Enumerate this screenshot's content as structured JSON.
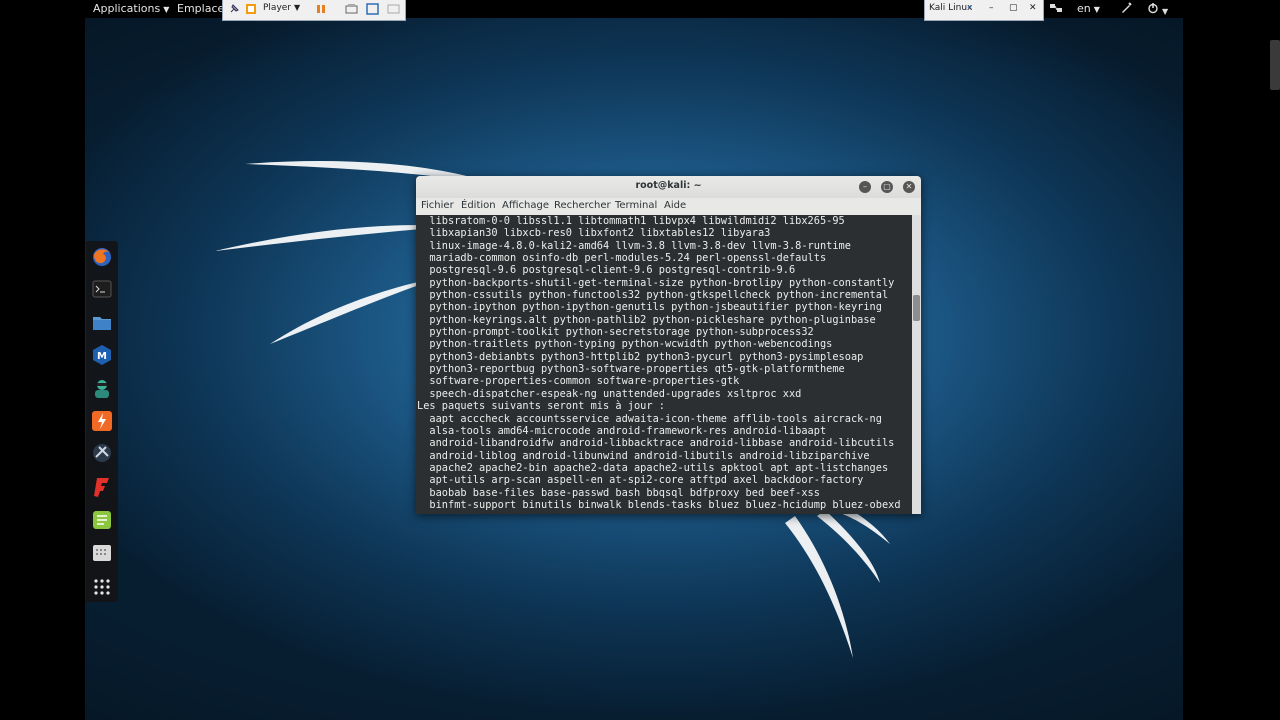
{
  "top_panel": {
    "applications": "Applications",
    "places": "Emplacements",
    "language": "en"
  },
  "vm_toolbar": {
    "player_label": "Player",
    "vm_name": "Kali Linux"
  },
  "dock_items": [
    {
      "name": "firefox-icon"
    },
    {
      "name": "terminal-icon"
    },
    {
      "name": "files-icon"
    },
    {
      "name": "maltego-icon"
    },
    {
      "name": "user-app-icon"
    },
    {
      "name": "burpsuite-icon"
    },
    {
      "name": "tool-icon"
    },
    {
      "name": "faraday-icon"
    },
    {
      "name": "notes-icon"
    },
    {
      "name": "keyboard-icon"
    },
    {
      "name": "show-apps-icon"
    }
  ],
  "terminal": {
    "title": "root@kali: ~",
    "menus": [
      "Fichier",
      "Édition",
      "Affichage",
      "Rechercher",
      "Terminal",
      "Aide"
    ],
    "lines": [
      "  libsratom-0-0 libssl1.1 libtommath1 libvpx4 libwildmidi2 libx265-95",
      "  libxapian30 libxcb-res0 libxfont2 libxtables12 libyara3",
      "  linux-image-4.8.0-kali2-amd64 llvm-3.8 llvm-3.8-dev llvm-3.8-runtime",
      "  mariadb-common osinfo-db perl-modules-5.24 perl-openssl-defaults",
      "  postgresql-9.6 postgresql-client-9.6 postgresql-contrib-9.6",
      "  python-backports-shutil-get-terminal-size python-brotlipy python-constantly",
      "  python-cssutils python-functools32 python-gtkspellcheck python-incremental",
      "  python-ipython python-ipython-genutils python-jsbeautifier python-keyring",
      "  python-keyrings.alt python-pathlib2 python-pickleshare python-pluginbase",
      "  python-prompt-toolkit python-secretstorage python-subprocess32",
      "  python-traitlets python-typing python-wcwidth python-webencodings",
      "  python3-debianbts python3-httplib2 python3-pycurl python3-pysimplesoap",
      "  python3-reportbug python3-software-properties qt5-gtk-platformtheme",
      "  software-properties-common software-properties-gtk",
      "  speech-dispatcher-espeak-ng unattended-upgrades xsltproc xxd",
      "Les paquets suivants seront mis à jour :",
      "  aapt acccheck accountsservice adwaita-icon-theme afflib-tools aircrack-ng",
      "  alsa-tools amd64-microcode android-framework-res android-libaapt",
      "  android-libandroidfw android-libbacktrace android-libbase android-libcutils",
      "  android-liblog android-libunwind android-libutils android-libziparchive",
      "  apache2 apache2-bin apache2-data apache2-utils apktool apt apt-listchanges",
      "  apt-utils arp-scan aspell-en at-spi2-core atftpd axel backdoor-factory",
      "  baobab base-files base-passwd bash bbqsql bdfproxy bed beef-xss",
      "  binfmt-support binutils binwalk blends-tasks bluez bluez-hcidump bluez-obexd"
    ]
  }
}
